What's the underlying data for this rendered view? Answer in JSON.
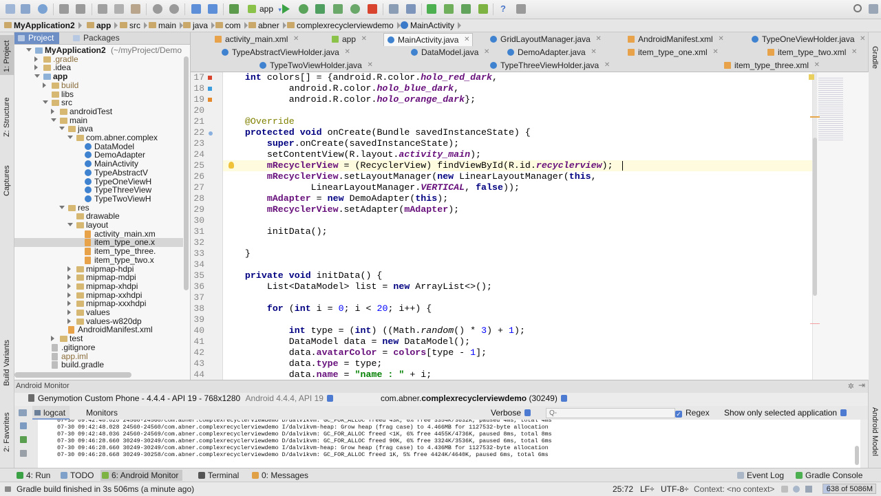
{
  "toolbar": {
    "run_config": "app"
  },
  "breadcrumb": [
    "MyApplication2",
    "app",
    "src",
    "main",
    "java",
    "com",
    "abner",
    "complexrecyclerviewdemo",
    "MainActivity"
  ],
  "left_strip": {
    "project": "1: Project",
    "structure": "Z: Structure",
    "captures": "Captures",
    "build_variants": "Build Variants",
    "favorites": "2: Favorites"
  },
  "right_strip": {
    "gradle": "Gradle",
    "android_model": "Android Model"
  },
  "project_panel": {
    "tabs": [
      "Project",
      "Packages"
    ],
    "tree": [
      {
        "label": "MyApplication2",
        "suffix": " (~/myProject/Demo",
        "depth": 0,
        "type": "module",
        "arrow": "open",
        "bold": true
      },
      {
        "label": ".gradle",
        "depth": 1,
        "type": "folder",
        "arrow": "closed",
        "muted": true
      },
      {
        "label": ".idea",
        "depth": 1,
        "type": "folder",
        "arrow": "closed"
      },
      {
        "label": "app",
        "depth": 1,
        "type": "module",
        "arrow": "open",
        "bold": true
      },
      {
        "label": "build",
        "depth": 2,
        "type": "folder",
        "arrow": "closed",
        "muted": true
      },
      {
        "label": "libs",
        "depth": 2,
        "type": "folder",
        "arrow": "none"
      },
      {
        "label": "src",
        "depth": 2,
        "type": "folder",
        "arrow": "open"
      },
      {
        "label": "androidTest",
        "depth": 3,
        "type": "folder",
        "arrow": "closed"
      },
      {
        "label": "main",
        "depth": 3,
        "type": "folder",
        "arrow": "open"
      },
      {
        "label": "java",
        "depth": 4,
        "type": "folder",
        "arrow": "open"
      },
      {
        "label": "com.abner.complex",
        "depth": 5,
        "type": "folder",
        "arrow": "open"
      },
      {
        "label": "DataModel",
        "depth": 6,
        "type": "cls",
        "arrow": "none"
      },
      {
        "label": "DemoAdapter",
        "depth": 6,
        "type": "cls",
        "arrow": "none"
      },
      {
        "label": "MainActivity",
        "depth": 6,
        "type": "cls",
        "arrow": "none"
      },
      {
        "label": "TypeAbstractV",
        "depth": 6,
        "type": "cls",
        "arrow": "none"
      },
      {
        "label": "TypeOneViewH",
        "depth": 6,
        "type": "cls",
        "arrow": "none"
      },
      {
        "label": "TypeThreeView",
        "depth": 6,
        "type": "cls",
        "arrow": "none"
      },
      {
        "label": "TypeTwoViewH",
        "depth": 6,
        "type": "cls",
        "arrow": "none"
      },
      {
        "label": "res",
        "depth": 4,
        "type": "folder",
        "arrow": "open"
      },
      {
        "label": "drawable",
        "depth": 5,
        "type": "folder",
        "arrow": "none"
      },
      {
        "label": "layout",
        "depth": 5,
        "type": "folder",
        "arrow": "open"
      },
      {
        "label": "activity_main.xm",
        "depth": 6,
        "type": "xml",
        "arrow": "none"
      },
      {
        "label": "item_type_one.x",
        "depth": 6,
        "type": "xml",
        "arrow": "none",
        "selected": true
      },
      {
        "label": "item_type_three.",
        "depth": 6,
        "type": "xml",
        "arrow": "none"
      },
      {
        "label": "item_type_two.x",
        "depth": 6,
        "type": "xml",
        "arrow": "none"
      },
      {
        "label": "mipmap-hdpi",
        "depth": 5,
        "type": "folder",
        "arrow": "closed"
      },
      {
        "label": "mipmap-mdpi",
        "depth": 5,
        "type": "folder",
        "arrow": "closed"
      },
      {
        "label": "mipmap-xhdpi",
        "depth": 5,
        "type": "folder",
        "arrow": "closed"
      },
      {
        "label": "mipmap-xxhdpi",
        "depth": 5,
        "type": "folder",
        "arrow": "closed"
      },
      {
        "label": "mipmap-xxxhdpi",
        "depth": 5,
        "type": "folder",
        "arrow": "closed"
      },
      {
        "label": "values",
        "depth": 5,
        "type": "folder",
        "arrow": "closed"
      },
      {
        "label": "values-w820dp",
        "depth": 5,
        "type": "folder",
        "arrow": "closed"
      },
      {
        "label": "AndroidManifest.xml",
        "depth": 4,
        "type": "xml",
        "arrow": "none"
      },
      {
        "label": "test",
        "depth": 3,
        "type": "folder",
        "arrow": "closed"
      },
      {
        "label": ".gitignore",
        "depth": 2,
        "type": "file",
        "arrow": "none"
      },
      {
        "label": "app.iml",
        "depth": 2,
        "type": "file",
        "arrow": "none",
        "muted": true
      },
      {
        "label": "build.gradle",
        "depth": 2,
        "type": "file",
        "arrow": "none"
      }
    ]
  },
  "editor_tabs": [
    [
      {
        "label": "activity_main.xml",
        "type": "xml",
        "close": true
      },
      {
        "label": "app",
        "type": "gr",
        "close": true
      },
      {
        "label": "MainActivity.java",
        "type": "cls",
        "close": true,
        "active": true
      },
      {
        "label": "GridLayoutManager.java",
        "type": "cls",
        "close": true
      },
      {
        "label": "AndroidManifest.xml",
        "type": "xml",
        "close": true
      },
      {
        "label": "TypeOneViewHolder.java",
        "type": "cls",
        "close": true
      }
    ],
    [
      {
        "label": "TypeAbstractViewHolder.java",
        "type": "cls",
        "close": true
      },
      {
        "label": "DataModel.java",
        "type": "cls",
        "close": true
      },
      {
        "label": "DemoAdapter.java",
        "type": "cls",
        "close": true
      },
      {
        "label": "item_type_one.xml",
        "type": "xml",
        "close": true
      },
      {
        "label": "item_type_two.xml",
        "type": "xml",
        "close": true
      }
    ],
    [
      {
        "label": "TypeTwoViewHolder.java",
        "type": "cls",
        "close": true
      },
      {
        "label": "TypeThreeViewHolder.java",
        "type": "cls",
        "close": true
      },
      {
        "label": "item_type_three.xml",
        "type": "xml",
        "close": true
      }
    ]
  ],
  "code": {
    "lines": [
      {
        "n": "17",
        "segs": [
          [
            "    ",
            ""
          ],
          [
            "int ",
            "kw"
          ],
          [
            "colors[] = {android.R.color.",
            ""
          ],
          [
            "holo_red_dark",
            "itb"
          ],
          [
            ",",
            ""
          ]
        ],
        "marker": "red"
      },
      {
        "n": "18",
        "segs": [
          [
            "            android.R.color.",
            ""
          ],
          [
            "holo_blue_dark",
            "itb"
          ],
          [
            ",",
            ""
          ]
        ],
        "marker": "blue"
      },
      {
        "n": "19",
        "segs": [
          [
            "            android.R.color.",
            ""
          ],
          [
            "holo_orange_dark",
            "itb"
          ],
          [
            "};",
            ""
          ]
        ],
        "marker": "orange"
      },
      {
        "n": "20",
        "segs": [
          [
            "",
            ""
          ]
        ]
      },
      {
        "n": "21",
        "segs": [
          [
            "    ",
            ""
          ],
          [
            "@Override",
            "ann"
          ]
        ]
      },
      {
        "n": "22",
        "segs": [
          [
            "    ",
            ""
          ],
          [
            "protected void ",
            "kw"
          ],
          [
            "onCreate(Bundle savedInstanceState) {",
            ""
          ]
        ]
      },
      {
        "n": "23",
        "segs": [
          [
            "        ",
            ""
          ],
          [
            "super",
            "kw"
          ],
          [
            ".onCreate(savedInstanceState);",
            ""
          ]
        ]
      },
      {
        "n": "24",
        "segs": [
          [
            "        setContentView(R.layout.",
            ""
          ],
          [
            "activity_main",
            "itb"
          ],
          [
            ");",
            ""
          ]
        ]
      },
      {
        "n": "25",
        "segs": [
          [
            "        ",
            ""
          ],
          [
            "mRecyclerView",
            "fld"
          ],
          [
            " = (RecyclerView) findViewById(R.id.",
            ""
          ],
          [
            "recyclerview",
            "itb"
          ],
          [
            ");",
            ""
          ]
        ],
        "current": true
      },
      {
        "n": "26",
        "segs": [
          [
            "        ",
            ""
          ],
          [
            "mRecyclerView",
            "fld"
          ],
          [
            ".setLayoutManager(",
            ""
          ],
          [
            "new ",
            "kw"
          ],
          [
            "LinearLayoutManager(",
            ""
          ],
          [
            "this",
            "kw"
          ],
          [
            ",",
            ""
          ]
        ]
      },
      {
        "n": "27",
        "segs": [
          [
            "                LinearLayoutManager.",
            ""
          ],
          [
            "VERTICAL",
            "itb"
          ],
          [
            ", ",
            ""
          ],
          [
            "false",
            "kw"
          ],
          [
            "));",
            ""
          ]
        ]
      },
      {
        "n": "28",
        "segs": [
          [
            "        ",
            ""
          ],
          [
            "mAdapter",
            "fld"
          ],
          [
            " = ",
            ""
          ],
          [
            "new ",
            "kw"
          ],
          [
            "DemoAdapter(",
            ""
          ],
          [
            "this",
            "kw"
          ],
          [
            ");",
            ""
          ]
        ]
      },
      {
        "n": "29",
        "segs": [
          [
            "        ",
            ""
          ],
          [
            "mRecyclerView",
            "fld"
          ],
          [
            ".setAdapter(",
            ""
          ],
          [
            "mAdapter",
            "fld"
          ],
          [
            ");",
            ""
          ]
        ]
      },
      {
        "n": "30",
        "segs": [
          [
            "",
            ""
          ]
        ]
      },
      {
        "n": "31",
        "segs": [
          [
            "        initData();",
            ""
          ]
        ]
      },
      {
        "n": "32",
        "segs": [
          [
            "",
            ""
          ]
        ]
      },
      {
        "n": "33",
        "segs": [
          [
            "    }",
            ""
          ]
        ]
      },
      {
        "n": "34",
        "segs": [
          [
            "",
            ""
          ]
        ]
      },
      {
        "n": "35",
        "segs": [
          [
            "    ",
            ""
          ],
          [
            "private void ",
            "kw"
          ],
          [
            "initData() {",
            ""
          ]
        ]
      },
      {
        "n": "36",
        "segs": [
          [
            "        List<DataModel> list = ",
            ""
          ],
          [
            "new ",
            "kw"
          ],
          [
            "ArrayList<>();",
            ""
          ]
        ]
      },
      {
        "n": "37",
        "segs": [
          [
            "",
            ""
          ]
        ]
      },
      {
        "n": "38",
        "segs": [
          [
            "        ",
            ""
          ],
          [
            "for ",
            "kw"
          ],
          [
            "(",
            ""
          ],
          [
            "int ",
            "kw"
          ],
          [
            "i = ",
            ""
          ],
          [
            "0",
            "num"
          ],
          [
            "; i < ",
            ""
          ],
          [
            "20",
            "num"
          ],
          [
            "; i++) {",
            ""
          ]
        ]
      },
      {
        "n": "39",
        "segs": [
          [
            "",
            ""
          ]
        ]
      },
      {
        "n": "40",
        "segs": [
          [
            "            ",
            ""
          ],
          [
            "int ",
            "kw"
          ],
          [
            "type = (",
            ""
          ],
          [
            "int",
            "kw"
          ],
          [
            ") ((Math.",
            ""
          ],
          [
            "random",
            "it"
          ],
          [
            "() * ",
            ""
          ],
          [
            "3",
            "num"
          ],
          [
            ") + ",
            ""
          ],
          [
            "1",
            "num"
          ],
          [
            ");",
            ""
          ]
        ]
      },
      {
        "n": "41",
        "segs": [
          [
            "            DataModel data = ",
            ""
          ],
          [
            "new ",
            "kw"
          ],
          [
            "DataModel();",
            ""
          ]
        ]
      },
      {
        "n": "42",
        "segs": [
          [
            "            data.",
            ""
          ],
          [
            "avatarColor",
            "fld"
          ],
          [
            " = ",
            ""
          ],
          [
            "colors",
            "fld"
          ],
          [
            "[type - ",
            ""
          ],
          [
            "1",
            "num"
          ],
          [
            "];",
            ""
          ]
        ]
      },
      {
        "n": "43",
        "segs": [
          [
            "            data.",
            ""
          ],
          [
            "type",
            "fld"
          ],
          [
            " = type;",
            ""
          ]
        ]
      },
      {
        "n": "44",
        "segs": [
          [
            "            data.",
            ""
          ],
          [
            "name",
            "fld"
          ],
          [
            " = ",
            ""
          ],
          [
            "\"name : \"",
            "str"
          ],
          [
            " + i;",
            ""
          ]
        ]
      }
    ]
  },
  "android_monitor": {
    "title": "Android Monitor",
    "device": "Genymotion Custom Phone - 4.4.4 - API 19 - 768x1280",
    "device_version": "Android 4.4.4, API 19",
    "process_pkg": "com.abner.",
    "process_name": "complexrecyclerviewdemo",
    "process_pid": " (30249)",
    "tabs": [
      "logcat",
      "Monitors"
    ],
    "level": "Verbose",
    "search_placeholder": "Q-",
    "regex_label": "Regex",
    "filter": "Show only selected application",
    "log_lines": [
      "07-30 09:42:48.020 24560-24560/com.abner.complexrecyclerviewdemo D/dalvikvm: GC_FOR_ALLOC freed 43K, 6% free 3354K/3632K, paused 4ms, total 4ms",
      "07-30 09:42:48.028 24560-24560/com.abner.complexrecyclerviewdemo I/dalvikvm-heap: Grow heap (frag case) to 4.466MB for 1127532-byte allocation",
      "07-30 09:42:48.036 24560-24569/com.abner.complexrecyclerviewdemo D/dalvikvm: GC_FOR_ALLOC freed <1K, 6% free 4455K/4736K, paused 8ms, total 8ms",
      "07-30 09:46:28.660 30249-30249/com.abner.complexrecyclerviewdemo D/dalvikvm: GC_FOR_ALLOC freed 90K, 6% free 3324K/3536K, paused 6ms, total 6ms",
      "07-30 09:46:28.660 30249-30249/com.abner.complexrecyclerviewdemo I/dalvikvm-heap: Grow heap (frag case) to 4.436MB for 1127532-byte allocation",
      "07-30 09:46:28.668 30249-30258/com.abner.complexrecyclerviewdemo D/dalvikvm: GC_FOR_ALLOC freed 1K, 5% free 4424K/4640K, paused 6ms, total 6ms"
    ]
  },
  "bottom_tools": {
    "run": "4: Run",
    "todo": "TODO",
    "monitor": "6: Android Monitor",
    "terminal": "Terminal",
    "messages": "0: Messages",
    "event_log": "Event Log",
    "gradle_console": "Gradle Console"
  },
  "status": {
    "message": "Gradle build finished in 3s 506ms (a minute ago)",
    "position": "25:72",
    "lf": "LF÷",
    "encoding": "UTF-8÷",
    "context": "Context: <no context>",
    "memory": "638 of 5086M",
    "memory_fraction": 0.125
  }
}
